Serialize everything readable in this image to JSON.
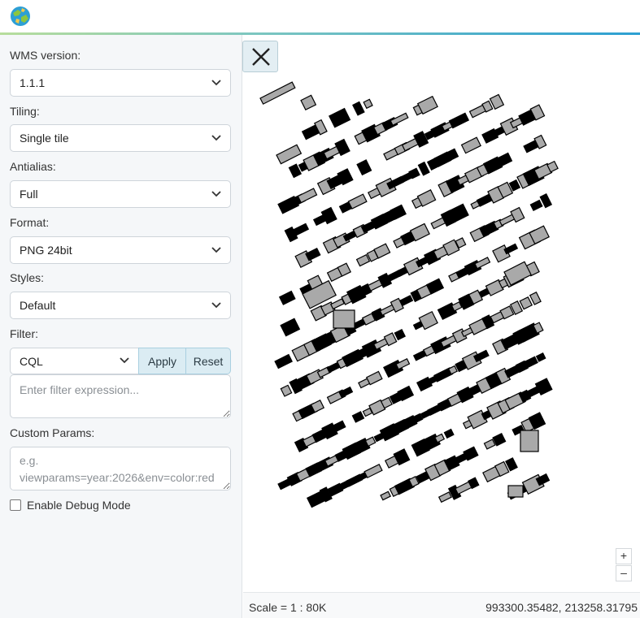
{
  "header": {
    "logo_icon": "geoserver-globe-icon",
    "accent_colors": [
      "#b7dd9c",
      "#7cc6c0",
      "#2c9fd2"
    ]
  },
  "sidebar": {
    "wms_version": {
      "label": "WMS version:",
      "value": "1.1.1"
    },
    "tiling": {
      "label": "Tiling:",
      "value": "Single tile"
    },
    "antialias": {
      "label": "Antialias:",
      "value": "Full"
    },
    "format": {
      "label": "Format:",
      "value": "PNG 24bit"
    },
    "styles": {
      "label": "Styles:",
      "value": "Default"
    },
    "filter": {
      "label": "Filter:",
      "type_value": "CQL",
      "apply_label": "Apply",
      "reset_label": "Reset",
      "placeholder": "Enter filter expression..."
    },
    "custom_params": {
      "label": "Custom Params:",
      "placeholder": "e.g. viewparams=year:2026&env=color:red"
    },
    "debug": {
      "label": "Enable Debug Mode",
      "checked": false
    }
  },
  "map": {
    "close_icon": "close-icon",
    "zoom_in_label": "+",
    "zoom_out_label": "–",
    "building_fill": "#a9a9a9",
    "building_stroke": "#000000"
  },
  "status": {
    "scale_text": "Scale = 1 : 80K",
    "coords_text": "993300.35482, 213258.31795"
  }
}
